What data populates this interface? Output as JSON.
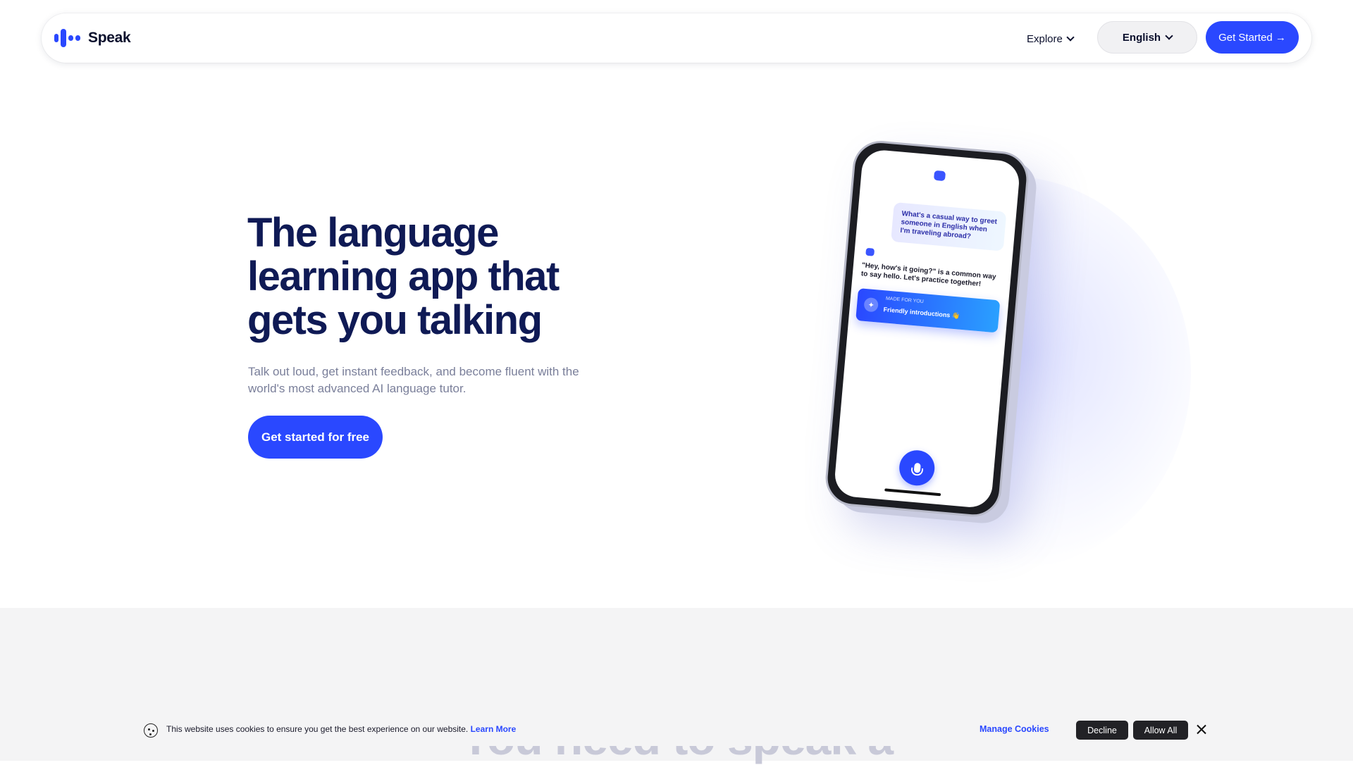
{
  "nav": {
    "logo_text": "Speak",
    "explore_label": "Explore",
    "language_label": "English",
    "cta_label": "Get Started →"
  },
  "hero": {
    "title": "The language learning app that gets you talking",
    "subtitle": "Talk out loud, get instant feedback, and become fluent with the world's most advanced AI language tutor.",
    "cta_label": "Get started for free"
  },
  "phone": {
    "user_message": "What's a casual way to greet someone in English when I'm traveling abroad?",
    "bot_message": "\"Hey, how's it going?\" is a common way to say hello. Let's practice together!",
    "card_tag": "MADE FOR YOU",
    "card_text": "Friendly introductions 👋"
  },
  "section": {
    "heading": "You need to speak a"
  },
  "cookie": {
    "text": "This website uses cookies to ensure you get the best experience on our website.",
    "learn_more": "Learn More",
    "manage": "Manage Cookies",
    "decline": "Decline",
    "allow": "Allow All"
  },
  "colors": {
    "accent": "#2a48ff",
    "heading": "#0f1a55",
    "muted": "#7a7f9a",
    "dark_button": "#222226"
  }
}
